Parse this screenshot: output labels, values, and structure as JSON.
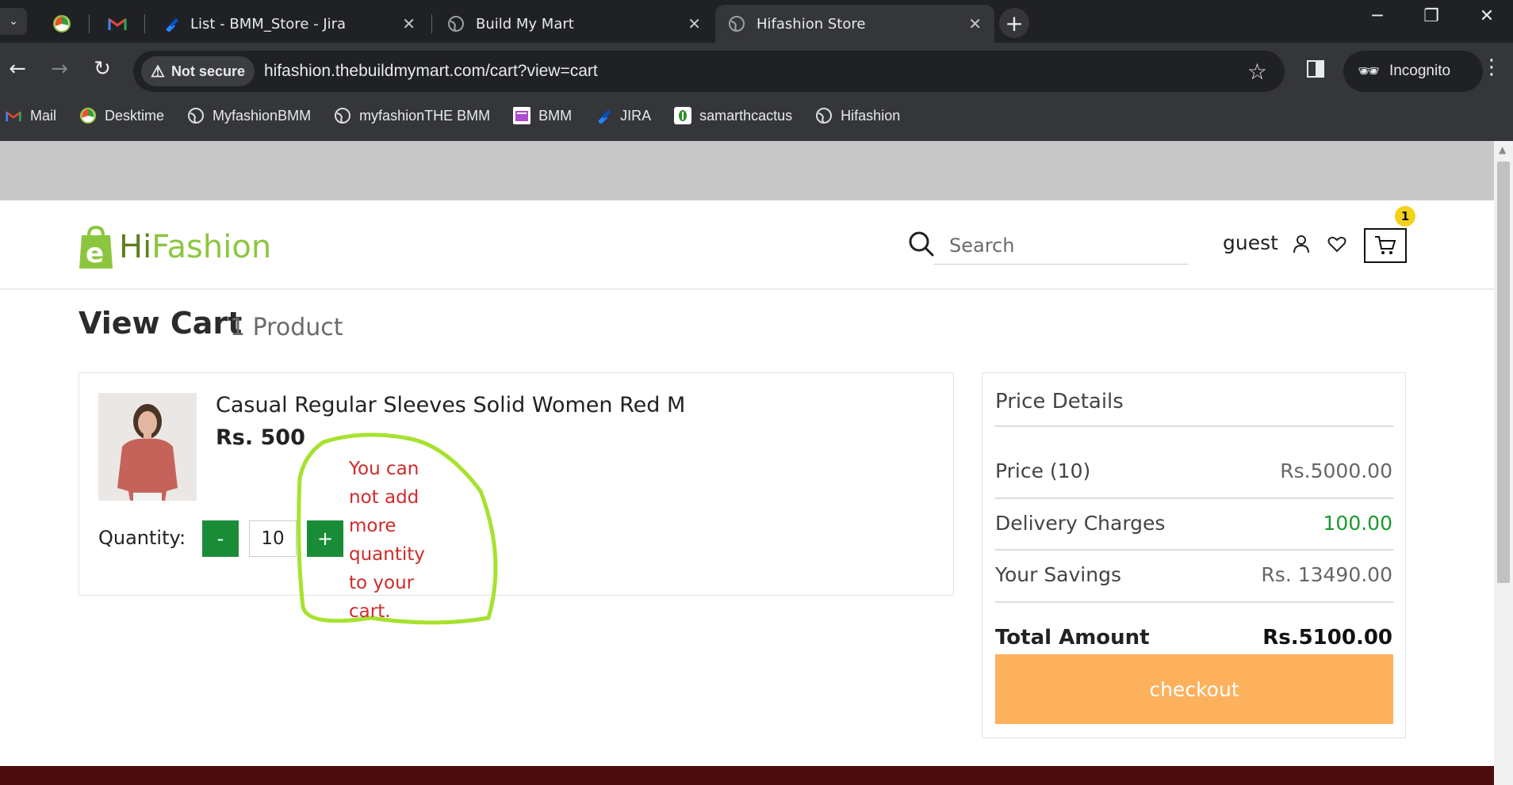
{
  "browser": {
    "tabs": [
      {
        "title": "",
        "icon": "desktime-icon",
        "pinned": true
      },
      {
        "title": "",
        "icon": "gmail-icon",
        "pinned": true
      },
      {
        "title": "List - BMM_Store - Jira",
        "icon": "jira-icon",
        "close": "✕"
      },
      {
        "title": "Build My Mart",
        "icon": "globe-icon",
        "close": "✕"
      },
      {
        "title": "Hifashion Store",
        "icon": "globe-icon",
        "close": "✕",
        "active": true
      }
    ],
    "new_tab": "+",
    "security_label": "Not secure",
    "url": "hifashion.thebuildmymart.com/cart?view=cart",
    "incognito_label": "Incognito",
    "bookmarks": [
      {
        "label": "Mail",
        "icon": "gmail-icon"
      },
      {
        "label": "Desktime",
        "icon": "desktime-icon"
      },
      {
        "label": "MyfashionBMM",
        "icon": "globe-icon"
      },
      {
        "label": "myfashionTHE BMM",
        "icon": "globe-icon"
      },
      {
        "label": "BMM",
        "icon": "bmm-icon"
      },
      {
        "label": "JIRA",
        "icon": "jira-icon"
      },
      {
        "label": "samarthcactus",
        "icon": "cactus-icon"
      },
      {
        "label": "Hifashion",
        "icon": "globe-icon"
      }
    ]
  },
  "site": {
    "logo_hi": "Hi",
    "logo_fashion": "Fashion",
    "search_placeholder": "Search",
    "user_label": "guest",
    "cart_count": "1"
  },
  "cart": {
    "heading": "View Cart",
    "count_label": "1 Product",
    "item": {
      "name": "Casual Regular Sleeves Solid Women Red M",
      "price": "Rs. 500",
      "quantity_label": "Quantity:",
      "quantity": "10",
      "minus": "-",
      "plus": "+"
    },
    "annotation": [
      "You can",
      "not add",
      "more",
      "quantity",
      "to your",
      "cart."
    ]
  },
  "price_details": {
    "title": "Price Details",
    "rows": [
      {
        "label": "Price (10)",
        "value": "Rs.5000.00"
      },
      {
        "label": "Delivery Charges",
        "value": "100.00"
      },
      {
        "label": "Your Savings",
        "value": "Rs. 13490.00"
      }
    ],
    "total_label": "Total Amount",
    "total_value": "Rs.5100.00",
    "checkout_label": "checkout"
  },
  "colors": {
    "brand_green": "#8cc63f",
    "qty_button": "#1a8c37",
    "checkout": "#fdb15d",
    "annotation_red": "#cf2b2b",
    "annotation_circle": "#a6e22e",
    "footer": "#4a0c0c"
  }
}
